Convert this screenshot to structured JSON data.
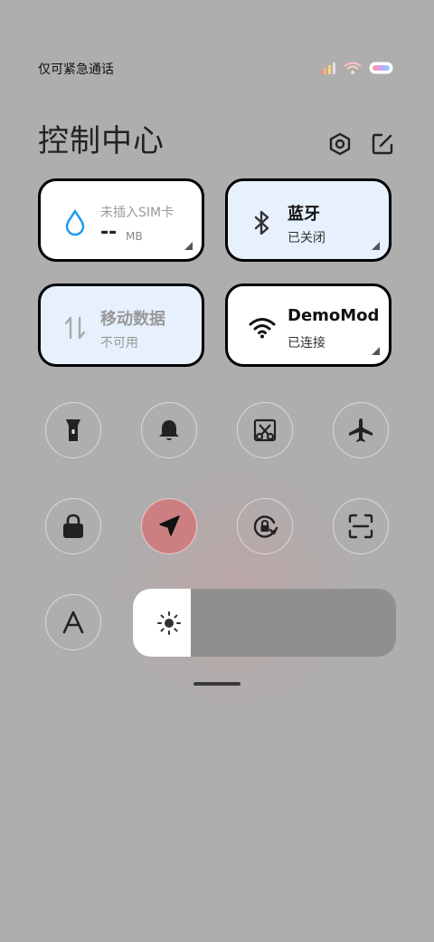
{
  "status_bar": {
    "carrier_text": "仅可紧急通话",
    "icons": [
      "signal-icon",
      "wifi-icon",
      "battery-icon"
    ]
  },
  "header": {
    "title": "控制中心",
    "settings_icon": "settings-icon",
    "edit_icon": "edit-icon"
  },
  "tiles": {
    "data_usage": {
      "label": "未插入SIM卡",
      "value": "--",
      "unit": "MB",
      "icon": "water-drop-icon"
    },
    "bluetooth": {
      "label": "蓝牙",
      "status": "已关闭",
      "icon": "bluetooth-icon"
    },
    "mobile_data": {
      "label": "移动数据",
      "status": "不可用",
      "icon": "mobile-data-icon"
    },
    "wifi": {
      "label": "DemoMode",
      "status": "已连接",
      "icon": "wifi-icon"
    }
  },
  "toggles": [
    {
      "name": "flashlight-icon",
      "active": false
    },
    {
      "name": "bell-icon",
      "active": false
    },
    {
      "name": "screenshot-icon",
      "active": false
    },
    {
      "name": "airplane-icon",
      "active": false
    },
    {
      "name": "lock-icon",
      "active": false
    },
    {
      "name": "location-icon",
      "active": true
    },
    {
      "name": "rotation-lock-icon",
      "active": false
    },
    {
      "name": "scan-icon",
      "active": false
    },
    {
      "name": "font-size-icon",
      "active": false
    }
  ],
  "brightness": {
    "level": 0.22,
    "icon": "sun-icon"
  },
  "colors": {
    "accent_active": "#cc7f80",
    "tile_blue": "#e6f1fd",
    "wifi_blue": "#3c8af6",
    "water_blue": "#1e9bf0"
  }
}
